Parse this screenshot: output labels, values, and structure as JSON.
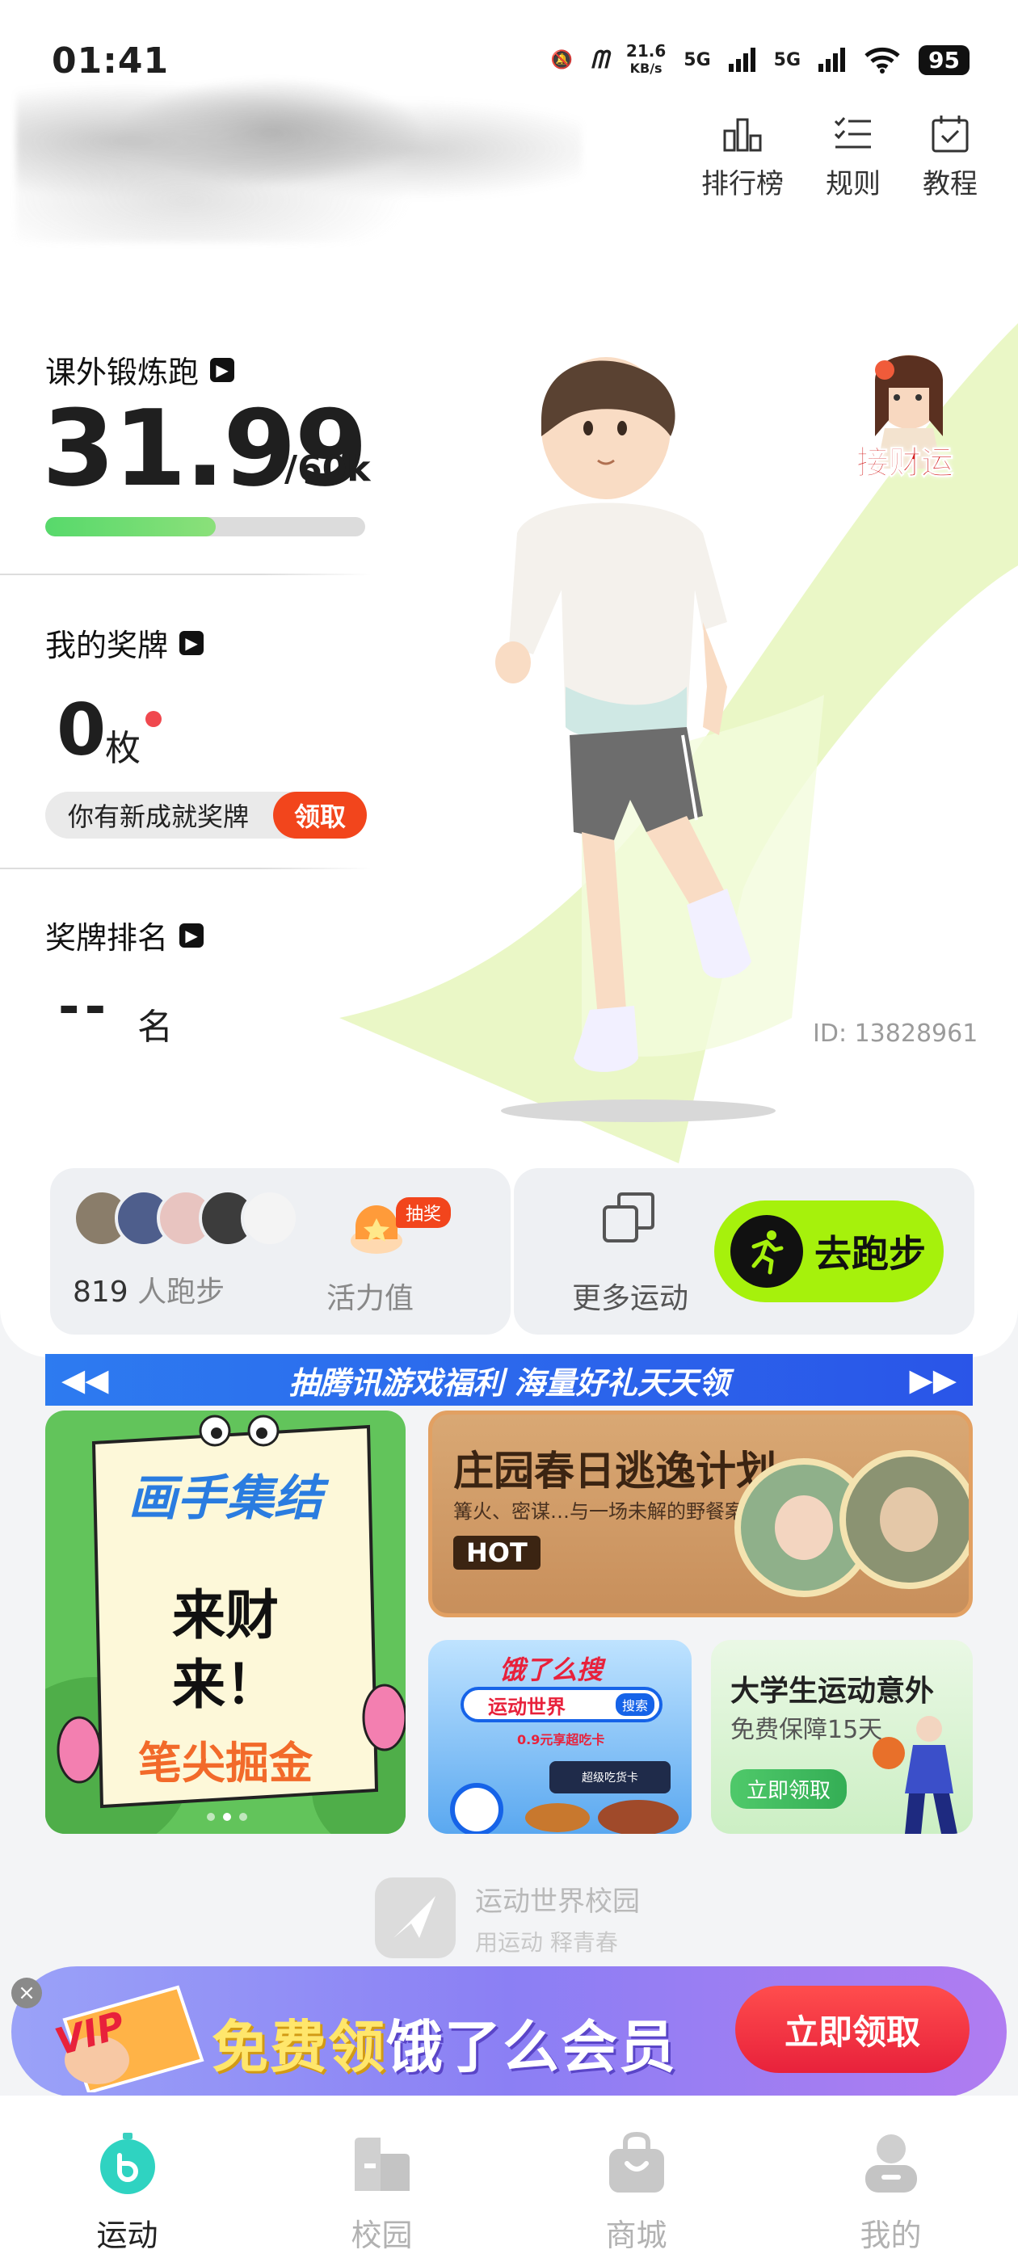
{
  "status_bar": {
    "time": "01:41",
    "net_speed": "21.6",
    "net_unit": "KB/s",
    "sim1": "5G",
    "sim2": "5G",
    "battery": "95"
  },
  "top_nav": [
    {
      "label": "排行榜",
      "icon": "leaderboard-icon"
    },
    {
      "label": "规则",
      "icon": "rules-list-icon"
    },
    {
      "label": "教程",
      "icon": "tutorial-calendar-icon"
    }
  ],
  "fortune": {
    "label": "接财运"
  },
  "exercise": {
    "title": "课外锻炼跑",
    "value": "31.99",
    "unit": "/60k",
    "progress_fraction": 0.533
  },
  "medals": {
    "title": "我的奖牌",
    "count": "0",
    "unit": "枚",
    "new_text": "你有新成就奖牌",
    "claim": "领取"
  },
  "ranking": {
    "title": "奖牌排名",
    "value": "--",
    "unit": "名"
  },
  "user_id": "ID: 13828961",
  "actions": {
    "runners_num": "819",
    "runners_text": " 人跑步",
    "lottery_badge": "抽奖",
    "vitality": "活力值",
    "more": "更多运动",
    "go_run": "去跑步"
  },
  "marquee": {
    "text": "抽腾讯游戏福利 海量好礼天天领"
  },
  "banners": {
    "artist": {
      "title": "画手集结",
      "line1": "来财",
      "line2": "来！",
      "line3": "笔尖掘金"
    },
    "manor": {
      "title": "庄园春日逃逸计划",
      "subtitle": "篝火、密谋…与一场未解的野餐案！",
      "badge": "HOT"
    },
    "eleme": {
      "title": "饿了么搜",
      "tag": "运动世界",
      "search": "搜索",
      "sub": "0.9元享超吃卡",
      "card": "超级吃货卡"
    },
    "insure": {
      "title": "大学生运动意外",
      "sub": "免费保障15天",
      "btn": "立即领取"
    }
  },
  "campus": {
    "name": "运动世界校园",
    "slogan": "用运动  释青春"
  },
  "vip": {
    "text_a": "免费领",
    "text_b": "饿了么会员",
    "btn": "立即领取",
    "badge": "VIP"
  },
  "bottom_nav": [
    {
      "label": "运动",
      "active": true
    },
    {
      "label": "校园",
      "active": false
    },
    {
      "label": "商城",
      "active": false
    },
    {
      "label": "我的",
      "active": false
    }
  ],
  "colors": {
    "accent_green": "#a6f10c",
    "claim_red": "#f2451c",
    "progress_green": "#57d96b",
    "marquee_blue": "#2d7bf0"
  }
}
